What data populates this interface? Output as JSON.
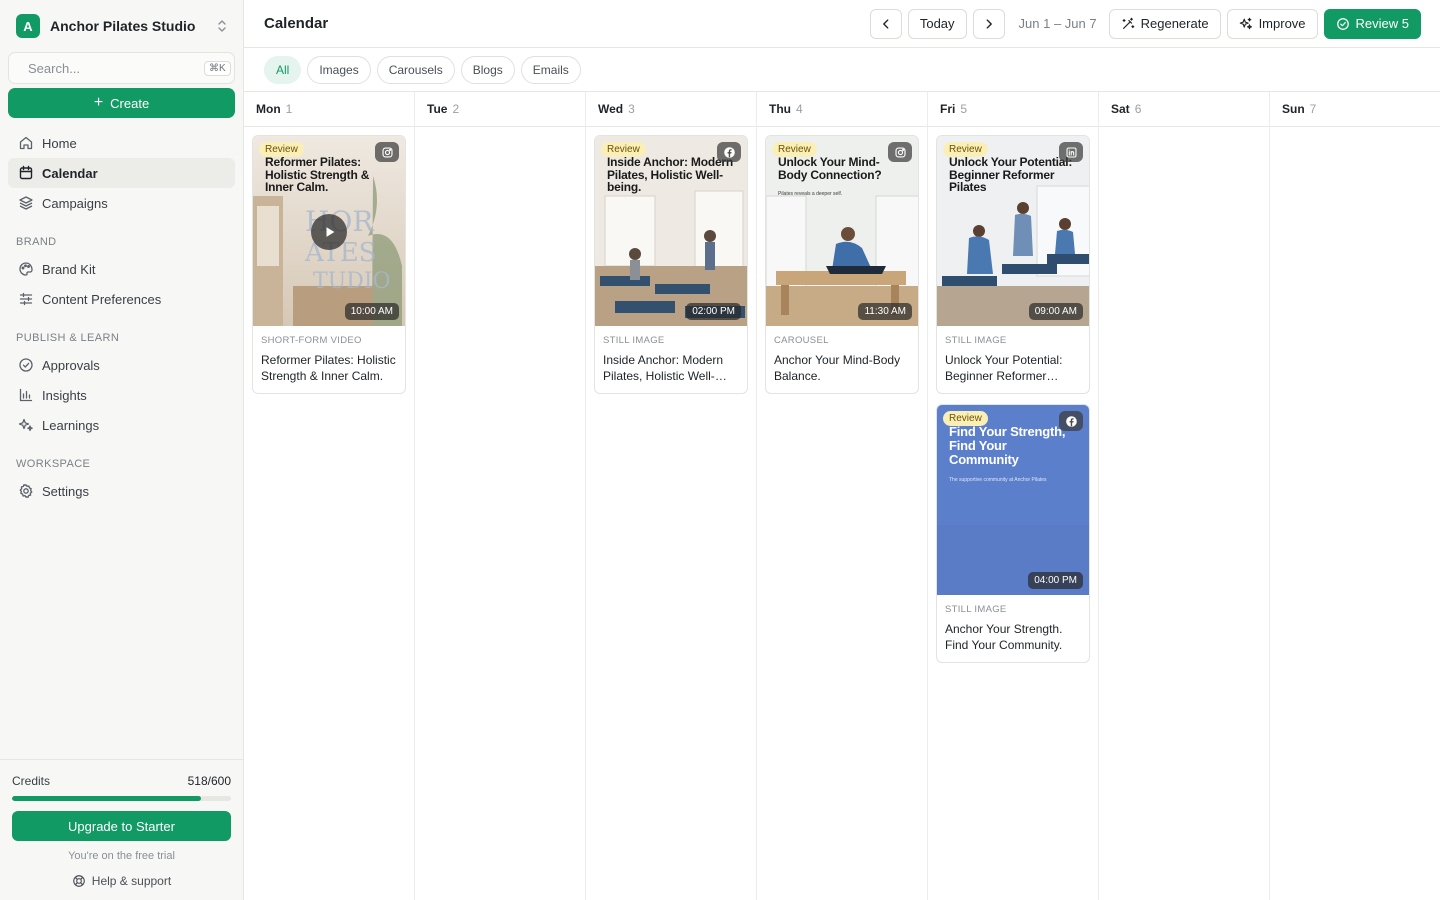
{
  "workspace": {
    "initial": "A",
    "name": "Anchor Pilates Studio"
  },
  "search": {
    "placeholder": "Search...",
    "shortcut": "⌘K"
  },
  "create_label": "Create",
  "nav": {
    "main": [
      {
        "label": "Home",
        "icon": "home-icon"
      },
      {
        "label": "Calendar",
        "icon": "calendar-icon",
        "active": true
      },
      {
        "label": "Campaigns",
        "icon": "layers-icon"
      }
    ],
    "brand_label": "BRAND",
    "brand": [
      {
        "label": "Brand Kit",
        "icon": "palette-icon"
      },
      {
        "label": "Content Preferences",
        "icon": "sliders-icon"
      }
    ],
    "publish_label": "PUBLISH & LEARN",
    "publish": [
      {
        "label": "Approvals",
        "icon": "check-circle-icon"
      },
      {
        "label": "Insights",
        "icon": "bar-chart-icon"
      },
      {
        "label": "Learnings",
        "icon": "sparkles-icon"
      }
    ],
    "workspace_label": "WORKSPACE",
    "workspace": [
      {
        "label": "Settings",
        "icon": "gear-icon"
      }
    ]
  },
  "credits": {
    "label": "Credits",
    "value": "518/600",
    "used": 518,
    "total": 600
  },
  "upgrade_label": "Upgrade to Starter",
  "trial_note": "You're on the free trial",
  "help_label": "Help & support",
  "header": {
    "title": "Calendar",
    "today_label": "Today",
    "date_range": "Jun 1 – Jun 7",
    "regenerate_label": "Regenerate",
    "improve_label": "Improve",
    "review_label": "Review 5"
  },
  "filters": [
    "All",
    "Images",
    "Carousels",
    "Blogs",
    "Emails"
  ],
  "days": [
    {
      "name": "Mon",
      "num": "1",
      "posts": [
        {
          "badge": "Review",
          "platform": "instagram-icon",
          "time": "10:00 AM",
          "headline": "Reformer Pilates: Holistic Strength & Inner Calm.",
          "type": "SHORT-FORM VIDEO",
          "title": "Reformer Pilates: Holistic Strength & Inner Calm.",
          "video": true,
          "scene": "brand"
        }
      ]
    },
    {
      "name": "Tue",
      "num": "2",
      "posts": []
    },
    {
      "name": "Wed",
      "num": "3",
      "posts": [
        {
          "badge": "Review",
          "platform": "facebook-icon",
          "time": "02:00 PM",
          "headline": "Inside Anchor: Modern Pilates, Holistic Well-being.",
          "type": "STILL IMAGE",
          "title": "Inside Anchor: Modern Pilates, Holistic Well-being.",
          "scene": "studio"
        }
      ]
    },
    {
      "name": "Thu",
      "num": "4",
      "posts": [
        {
          "badge": "Review",
          "platform": "instagram-icon",
          "time": "11:30 AM",
          "headline": "Unlock Your Mind-Body Connection?",
          "subline": "Pilates reveals a deeper self.",
          "type": "CAROUSEL",
          "title": "Anchor Your Mind-Body Balance.",
          "scene": "reformer"
        }
      ]
    },
    {
      "name": "Fri",
      "num": "5",
      "posts": [
        {
          "badge": "Review",
          "platform": "linkedin-icon",
          "time": "09:00 AM",
          "headline": "Unlock Your Potential: Beginner Reformer Pilates",
          "type": "STILL IMAGE",
          "title": "Unlock Your Potential: Beginner Reformer Pilates",
          "scene": "class"
        },
        {
          "badge": "Review",
          "platform": "facebook-icon",
          "time": "04:00 PM",
          "headline": "Find Your Strength, Find Your Community",
          "subline": "The supportive community at Anchor Pilates",
          "type": "STILL IMAGE",
          "title": "Anchor Your Strength. Find Your Community.",
          "scene": "blue"
        }
      ]
    },
    {
      "name": "Sat",
      "num": "6",
      "posts": []
    },
    {
      "name": "Sun",
      "num": "7",
      "posts": []
    }
  ],
  "colors": {
    "accent": "#129a64",
    "review_badge": "#fbefb8",
    "active_chip_bg": "#e5f4ee"
  }
}
